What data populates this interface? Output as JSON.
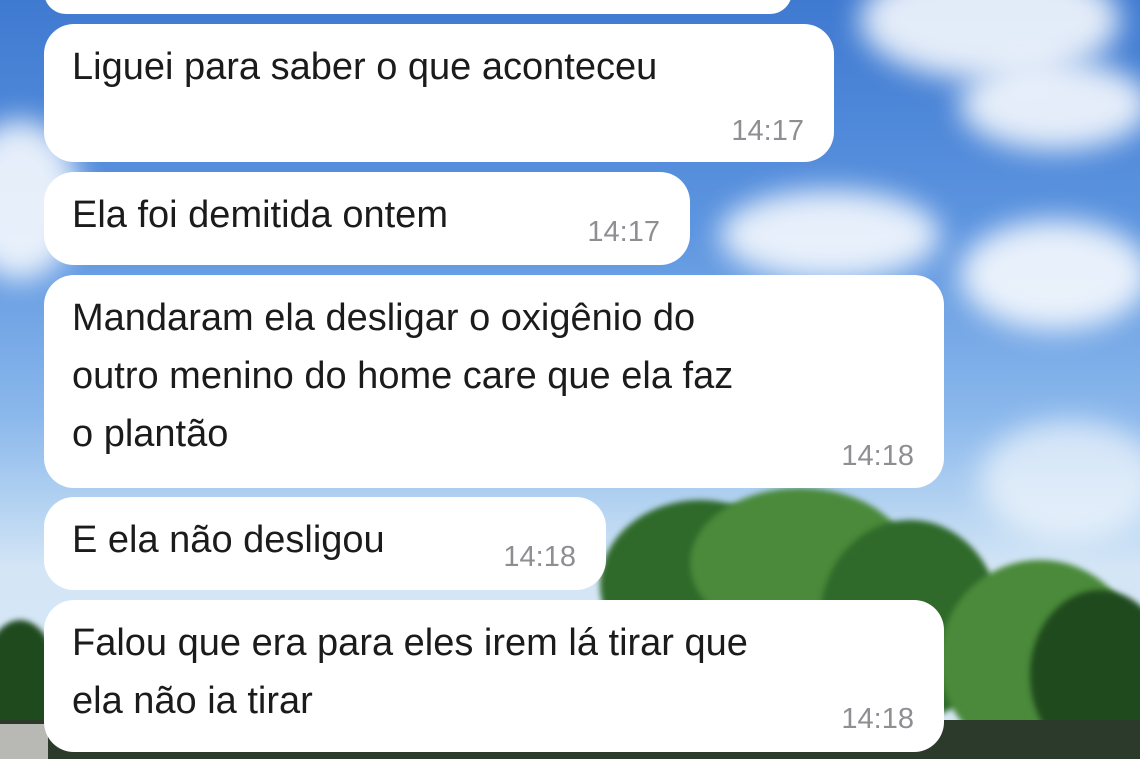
{
  "messages": [
    {
      "text": "Liguei para saber o que aconteceu",
      "time": "14:17"
    },
    {
      "text": "Ela foi demitida ontem",
      "time": "14:17"
    },
    {
      "text": "Mandaram ela desligar o oxigênio do\noutro menino do home care que ela faz\no plantão",
      "time": "14:18"
    },
    {
      "text": "E ela não desligou",
      "time": "14:18"
    },
    {
      "text": "Falou que era para eles irem lá tirar que\nela não ia tirar",
      "time": "14:18"
    }
  ],
  "colors": {
    "bubble": "#ffffff",
    "text": "#1b1b1b",
    "timestamp": "#8e8e93",
    "sky": "#4f86d6"
  }
}
